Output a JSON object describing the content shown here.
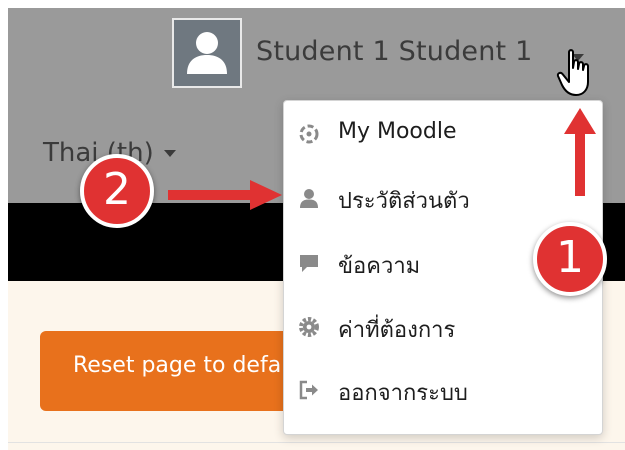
{
  "header": {
    "user_name": "Student 1 Student 1",
    "language": "Thai (th)"
  },
  "user_menu": {
    "items": [
      {
        "label": "My Moodle",
        "icon": "dashboard-icon"
      },
      {
        "label": "ประวัติส่วนตัว",
        "icon": "user-icon"
      },
      {
        "label": "ข้อความ",
        "icon": "comment-icon"
      },
      {
        "label": "ค่าที่ต้องการ",
        "icon": "gear-icon"
      },
      {
        "label": "ออกจากระบบ",
        "icon": "sign-out-icon"
      }
    ]
  },
  "main": {
    "reset_button_label": "Reset page to default"
  },
  "annotations": {
    "step_1": "1",
    "step_2": "2"
  },
  "colors": {
    "header_bg": "#9a9a9a",
    "accent_orange": "#e8711c",
    "annotation_red": "#e03232",
    "content_bg": "#fdf6ec"
  }
}
